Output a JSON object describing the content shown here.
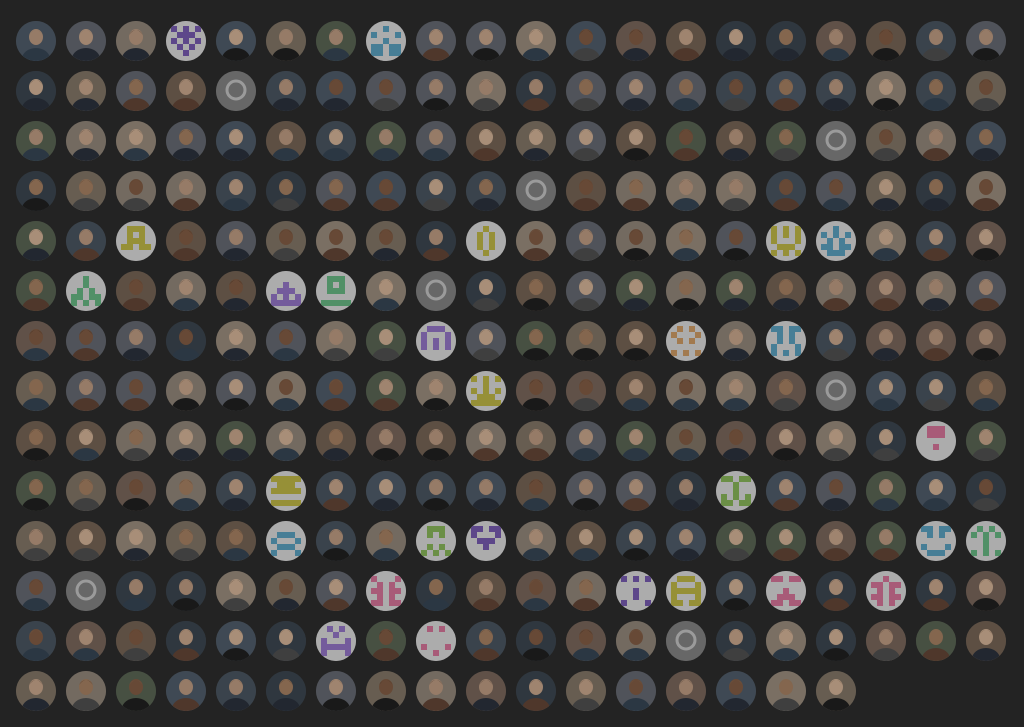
{
  "wall": {
    "rows": 14,
    "columns": 20,
    "total_avatars": 277,
    "colors": {
      "background": "#232323",
      "photo_palette": [
        "#6b6f78",
        "#8a7d6d",
        "#4e5a66",
        "#9a8e80",
        "#5f6b58",
        "#7c6a5a",
        "#3f4a55",
        "#a39585",
        "#556270",
        "#806d60"
      ],
      "identicon_palette": [
        "#7c5fb8",
        "#8fbf5e",
        "#d9a36a",
        "#5fa9c9",
        "#e07aa0",
        "#c9c14a",
        "#9b7bd1",
        "#6cc08a"
      ],
      "github_logo_bg": "#8a8a8a"
    },
    "avatar_types": [
      "photo",
      "photo",
      "photo",
      "identicon",
      "photo",
      "photo",
      "photo",
      "identicon",
      "photo",
      "photo",
      "photo",
      "photo",
      "photo",
      "photo",
      "photo",
      "photo",
      "photo",
      "photo",
      "photo",
      "photo",
      "photo",
      "photo",
      "photo",
      "photo",
      "github",
      "photo",
      "photo",
      "photo",
      "photo",
      "photo",
      "photo",
      "photo",
      "photo",
      "photo",
      "photo",
      "photo",
      "photo",
      "photo",
      "photo",
      "photo",
      "photo",
      "photo",
      "photo",
      "photo",
      "photo",
      "photo",
      "photo",
      "photo",
      "photo",
      "photo",
      "photo",
      "photo",
      "photo",
      "photo",
      "photo",
      "photo",
      "github",
      "photo",
      "photo",
      "photo",
      "photo",
      "photo",
      "photo",
      "photo",
      "photo",
      "photo",
      "photo",
      "photo",
      "photo",
      "photo",
      "github",
      "photo",
      "photo",
      "photo",
      "photo",
      "photo",
      "photo",
      "photo",
      "photo",
      "photo",
      "photo",
      "photo",
      "identicon",
      "photo",
      "photo",
      "photo",
      "photo",
      "photo",
      "photo",
      "identicon",
      "photo",
      "photo",
      "photo",
      "photo",
      "photo",
      "identicon",
      "identicon",
      "photo",
      "photo",
      "photo",
      "photo",
      "identicon",
      "photo",
      "photo",
      "photo",
      "identicon",
      "identicon",
      "photo",
      "github",
      "photo",
      "photo",
      "photo",
      "photo",
      "photo",
      "photo",
      "photo",
      "photo",
      "photo",
      "photo",
      "photo",
      "photo",
      "photo",
      "photo",
      "photo",
      "photo",
      "photo",
      "photo",
      "photo",
      "identicon",
      "photo",
      "photo",
      "photo",
      "photo",
      "identicon",
      "photo",
      "identicon",
      "photo",
      "photo",
      "photo",
      "photo",
      "photo",
      "photo",
      "photo",
      "photo",
      "photo",
      "photo",
      "photo",
      "photo",
      "photo",
      "identicon",
      "photo",
      "photo",
      "photo",
      "photo",
      "photo",
      "photo",
      "github",
      "photo",
      "photo",
      "photo",
      "photo",
      "photo",
      "photo",
      "photo",
      "photo",
      "photo",
      "photo",
      "photo",
      "photo",
      "photo",
      "photo",
      "photo",
      "photo",
      "photo",
      "photo",
      "photo",
      "photo",
      "photo",
      "identicon",
      "photo",
      "photo",
      "photo",
      "photo",
      "photo",
      "photo",
      "identicon",
      "photo",
      "photo",
      "photo",
      "photo",
      "photo",
      "photo",
      "photo",
      "photo",
      "identicon",
      "photo",
      "photo",
      "photo",
      "photo",
      "photo",
      "photo",
      "photo",
      "photo",
      "photo",
      "photo",
      "identicon",
      "photo",
      "photo",
      "identicon",
      "identicon",
      "photo",
      "photo",
      "photo",
      "photo",
      "photo",
      "photo",
      "photo",
      "photo",
      "identicon",
      "identicon",
      "photo",
      "github",
      "photo",
      "photo",
      "photo",
      "photo",
      "photo",
      "identicon",
      "photo",
      "photo",
      "photo",
      "photo",
      "identicon",
      "identicon",
      "photo",
      "identicon",
      "photo",
      "identicon",
      "photo",
      "photo",
      "photo",
      "photo",
      "photo",
      "photo",
      "photo",
      "photo",
      "identicon",
      "photo",
      "identicon",
      "photo",
      "photo",
      "photo",
      "photo",
      "github",
      "photo",
      "photo",
      "photo",
      "photo",
      "photo",
      "photo",
      "photo",
      "photo",
      "photo",
      "photo",
      "photo",
      "photo",
      "photo",
      "photo",
      "photo",
      "photo",
      "photo",
      "photo",
      "photo",
      "photo",
      "photo",
      "photo",
      "photo"
    ]
  }
}
